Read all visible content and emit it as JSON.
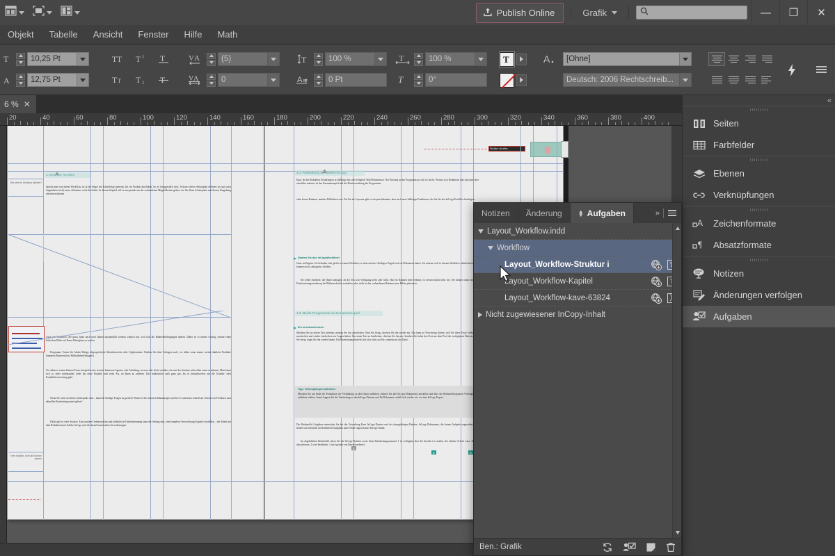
{
  "appbar": {
    "tool_dropdowns": [
      "bridge-icon",
      "screenmode-icon",
      "arrange-icon"
    ],
    "publish_label": "Publish Online",
    "publish_icon": "upload-icon",
    "workspace_label": "Grafik",
    "search_placeholder": "",
    "search_value": "",
    "search_icon": "search-icon",
    "minimize": "—",
    "restore": "❐",
    "close": "✕"
  },
  "menubar": {
    "items": [
      {
        "label": "Objekt"
      },
      {
        "label": "Tabelle"
      },
      {
        "label": "Ansicht"
      },
      {
        "label": "Fenster"
      },
      {
        "label": "Hilfe"
      },
      {
        "label": "Math"
      }
    ]
  },
  "controlbar": {
    "font_size": "10,25 Pt",
    "leading": "12,75 Pt",
    "kerning": "(5)",
    "tracking": "0",
    "horizontal_scale": "100 %",
    "vertical_scale": "100 %",
    "baseline_shift": "0 Pt",
    "skew": "0°",
    "character_style": "[Ohne]",
    "language": "Deutsch: 2006 Rechtschreib...",
    "caps_icon": "all-caps-icon",
    "smallcaps_icon": "small-caps-icon",
    "superscript_icon": "superscript-icon",
    "subscript_icon": "subscript-icon",
    "underline_icon": "underline-icon",
    "strikethrough_icon": "strikethrough-icon",
    "quick_apply_icon": "quick-apply-icon",
    "panel_menu_icon": "panel-menu-icon",
    "align_row1": [
      "align-left",
      "align-center",
      "align-right",
      "justify-last-left"
    ],
    "align_row2": [
      "justify-all",
      "justify-center",
      "justify-right",
      "align-toward-spine"
    ]
  },
  "doctab": {
    "title": "6 %",
    "close": "✕"
  },
  "ruler": {
    "unit": "mm",
    "labels": [
      "20",
      "40",
      "60",
      "80",
      "100",
      "120",
      "140",
      "160",
      "180",
      "200",
      "220",
      "240",
      "260",
      "280",
      "300",
      "320",
      "340",
      "360",
      "380",
      "400"
    ]
  },
  "document": {
    "left_page": {
      "heading": "1.  Struktur ist alles",
      "para1": "Spricht man von einem Workflow, ist in der Regel die Schrittfolge gemeint, die ein Produkt durchläuft, bis es fertiggestellt wird. Je klarer dieser Ablaufplan definiert ist (und auch eingehalten wird), umso effizienter wird die Arbeit. In diesem Kapitel soll es nun primär um die vorhandenen Möglichkeiten gehen, wie Sie Ihren Arbeitsplatz und dessen Umgebung einrichten können.",
      "para2": "Auch ein Workflow, der passt, kann nach zwei Jahren umständlich werden, einfach nur, weil sich die Rahmenbedingungen ändern. Daher ist es immer wichtig, einmal einen kritischen Blick auf Ihren Ablaufplan zu werfen.",
      "para3": "Programm. Testen Sie Adobe Bridge, abgespeicherte Arbeitsbereiche oder Glyphensätze. Denken Sie über Vorlagen nach, vor allem wenn immer wieder ähnliche Produkte kommen (Musterseiten, Bibliotheken/Snippets).",
      "para4": "Vor allem in einem kleinen Team, beispielsweise in einer kleineren Agentur oder Abteilung, ist man sehr leicht verführt, das mit der Struktur nicht allzu ernst zu nehmen. Man kennt sich ja, redet miteinander, jeder hat seine Projekte und seine Art, an ihnen zu arbeiten. Das funktioniert auch ganz gut, bis es beispielsweise um die Urlaubs- oder Krankheitsvertretung geht.",
      "para5": "Wenn Sie nicht an Ihrem Arbeitsplatz sind – kann Ihr Kollege Fragen zu greifen? Findet er die neuesten Manuskripte und Server und kann schnell am Telefon ein Feedback zum aktuellen Bearbeitungsstand geben?",
      "para6": "Dafür gibt es viele Ansätze. Eine saubere Ordnerstruktur und einheitliche Dateibenennung kann der Anfang sein, eine komplexe Serverlösung Kapitel vorstellbar – die Arbeit mit dem Redaktionstool Adobe InCopy und die darauf basierenden Serverlösungen.",
      "margin_note_1": "Wie wird ein Workflow definiert?",
      "margin_note_2": "Viele Ansätze, nicht alle können passen",
      "sticky_note": "handwritten-annotation"
    },
    "right_page": {
      "heading1": "1.1.  Anbindung zu Adobe InCopy",
      "para1": "Egal, ob der Redakteur Erfahrungen in InDesign hat oder lediglich Word-Kenntnisse: Der Einstieg in das Programm an sich ist leicht. Worauf sich Redakteur und Layouter aber einstellen müssen, ist das Zusammenspiel und die Dateiverwaltung der Programme.",
      "para2": "ohne leeren Rahmen, unnütze Hilfslinien usw. Für Sie als Layouter gibt es ein paar bekannte, aber auch neue InDesign-Funktionen, die Sie für den InCopyWorkflow benötigen.",
      "sub1": "Starten Sie den InCopyWorkflow!",
      "para3": "Ganz zu Beginn: Sie befinden sich gleich in einem Workflow, in dem mehrere Kollegen Zugriff auf ein Dokument haben. Sie müssen sich in diesem Workflow identifizieren und können nicht »inkognito« bleiben.",
      "para4": "Sie sehen Symbole, die Ihnen anzeigen, ob der Text zur Verfügung steht oder nicht. Hat ein Rahmen kein Symbol, ist dessen Inhalt nicht frei. Sie können dann mit dem Positionierungswerkzeug die Bildausschnitte verändern, aber nicht in den vorhandenen Rahmen neue Bilder platzieren.",
      "heading2": "1.2.  Beide Programme im Zusammenspiel",
      "sub2": "Ein und Auschecken",
      "para5": "Möchten Sie an einem Text arbeiten, müssen Sie ihn auschecken. Sind Sie fertig, checken Sie ihn wieder ein. Das kann zu Verwirrung führen, weil Sie diese Texte vieSie sich auschecken und wieder einchecken vor Augen halten: Um einen Text zu bearbeiten, checken Sie ihn aus. Sondern Sie holen den Text aus dem Pool der verfügbaren Dateien. Sind Sie fertig, legen Sie ihn wieder hinein. Die Bezeichnung bezieht sich also nicht auf Sie, sondern auf die Datei.",
      "tip_title": "Tipp: Verknüpfungen aufheben!",
      "tip_body": "Möchten Sie am Ende der Produktion die Verbindung zu den Daten aufheben, können Sie alle InCopy-Dokumente anwählen und über die Bedienfeldoptionen Verknüpfung aufheben wählen. Somit kappen Sie die Verbindung zu den InCopy-Dateien und Ihr Dokument verhält sich wieder wie vor dem InCopy-Export.",
      "para6": "Das Bedienfeld Aufgaben unterstützt Sie bei der Verwaltung Ihrer InCopy-Dateien und der dazugehörigen Dateien. InCopy-Dokumente, die keiner Aufgabe zugeordnet sind, finden sich ebenfalls im Bedienfeld Aufgaben unter Nicht zugewiesener InCopy-Inhalt.",
      "para7": "Im abgebildeten Bedienfeld sehen Sie die InCopy-Dateien sowie deren Bearbeitungszustand. 1 ist verfügbar, aber die Ansicht ist veraltet, der nächste Schritt wäre, dies zu aktualisieren. 2 wird bearbeitet, 3 wird gerade von Ihnen bearbeitet.",
      "callouts": [
        "1",
        "2",
        "3"
      ],
      "pasteboard_label": "Struktur ist alles"
    }
  },
  "aufgaben_panel": {
    "tabs": [
      {
        "label": "Notizen",
        "active": false
      },
      {
        "label": "Änderung",
        "active": false
      },
      {
        "label": "Aufgaben",
        "active": true
      }
    ],
    "expand_icon": "chevrons-right-icon",
    "menu_icon": "panel-menu-icon",
    "tree": [
      {
        "label": "Layout_Workflow.indd",
        "depth": 0,
        "expanded": true,
        "selected": false,
        "bold": false,
        "icons": []
      },
      {
        "label": "Workflow",
        "depth": 1,
        "expanded": true,
        "selected": true,
        "bold": false,
        "icons": []
      },
      {
        "label": "Layout_Workflow-Struktur i",
        "depth": 2,
        "expanded": null,
        "selected": true,
        "bold": true,
        "icons": [
          "globe-download-icon",
          "text-frame-icon"
        ]
      },
      {
        "label": "Layout_Workflow-Kapitel",
        "depth": 2,
        "expanded": null,
        "selected": false,
        "bold": false,
        "icons": [
          "globe-download-icon",
          "text-frame-icon"
        ]
      },
      {
        "label": "Layout_Workflow-kave-63824",
        "depth": 2,
        "expanded": null,
        "selected": false,
        "bold": false,
        "icons": [
          "globe-download-icon",
          "graphic-frame-icon"
        ]
      },
      {
        "label": "Nicht zugewiesener InCopy-Inhalt",
        "depth": 0,
        "expanded": false,
        "selected": false,
        "bold": false,
        "icons": []
      }
    ],
    "footer": {
      "user_label": "Ben.: Grafik",
      "icons": [
        "refresh-icon",
        "new-assignment-icon",
        "new-item-icon",
        "delete-icon"
      ]
    }
  },
  "dock": {
    "collapse_icon": "chevrons-left-icon",
    "groups": [
      {
        "items": [
          {
            "label": "Seiten",
            "icon": "pages-icon",
            "active": false
          },
          {
            "label": "Farbfelder",
            "icon": "swatches-icon",
            "active": false
          }
        ]
      },
      {
        "items": [
          {
            "label": "Ebenen",
            "icon": "layers-icon",
            "active": false
          },
          {
            "label": "Verknüpfungen",
            "icon": "links-icon",
            "active": false
          }
        ]
      },
      {
        "items": [
          {
            "label": "Zeichenformate",
            "icon": "character-styles-icon",
            "active": false
          },
          {
            "label": "Absatzformate",
            "icon": "paragraph-styles-icon",
            "active": false
          }
        ]
      },
      {
        "items": [
          {
            "label": "Notizen",
            "icon": "notes-icon",
            "active": false
          },
          {
            "label": "Änderungen verfolgen",
            "icon": "track-changes-icon",
            "active": false
          },
          {
            "label": "Aufgaben",
            "icon": "assignments-icon",
            "active": true
          }
        ]
      }
    ]
  },
  "colors": {
    "app_bg": "#3c3c3c",
    "panel_bg": "#444444",
    "accent_teal": "#2a9d8f",
    "accent_red": "#c0392b",
    "selection_blue": "#5a6780",
    "publish_border": "#8e5b66"
  }
}
